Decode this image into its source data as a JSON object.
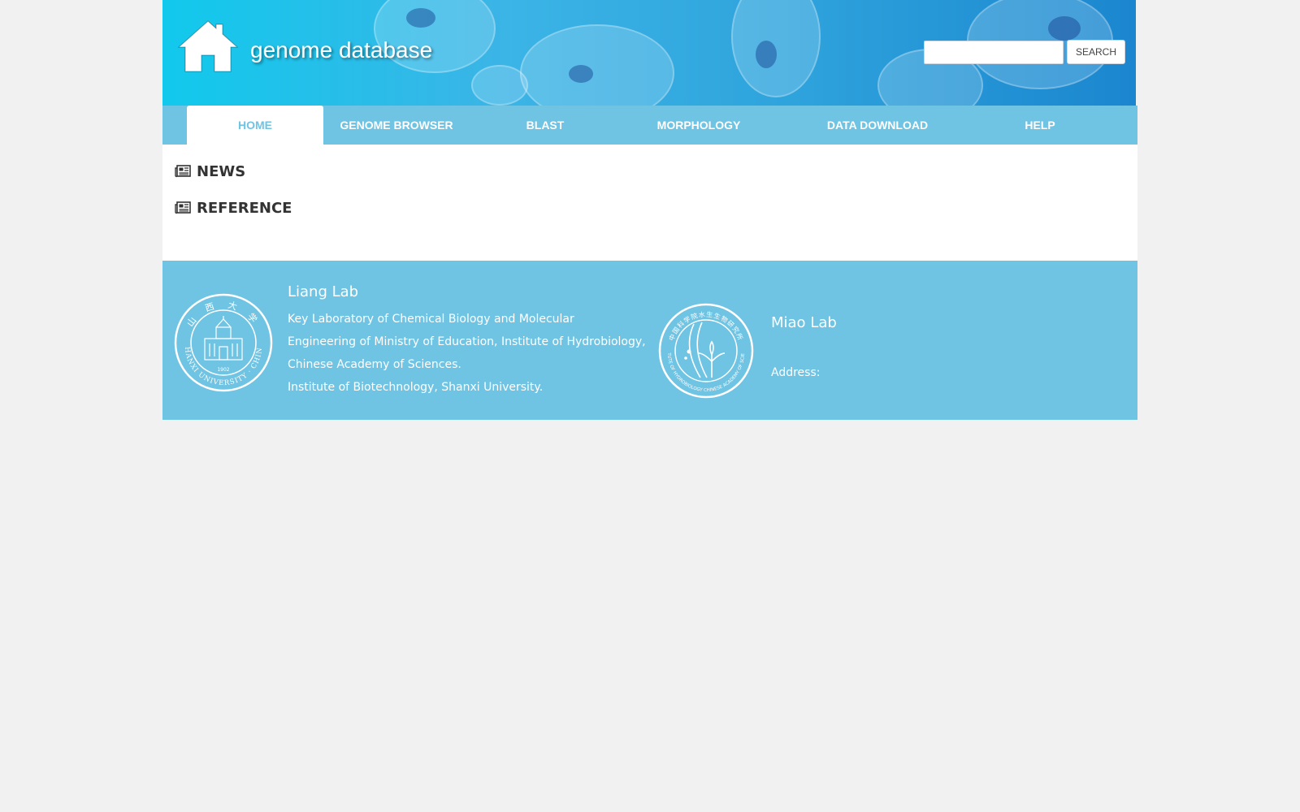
{
  "header": {
    "site_title": "genome database",
    "search": {
      "placeholder": "",
      "button_label": "SEARCH"
    }
  },
  "nav": {
    "items": [
      {
        "label": "HOME",
        "active": true
      },
      {
        "label": "GENOME BROWSER"
      },
      {
        "label": "BLAST"
      },
      {
        "label": "MORPHOLOGY"
      },
      {
        "label": "DATA DOWNLOAD"
      },
      {
        "label": "HELP"
      }
    ]
  },
  "content": {
    "sections": [
      {
        "title": "NEWS",
        "icon": "newspaper-icon"
      },
      {
        "title": "REFERENCE",
        "icon": "newspaper-icon"
      }
    ]
  },
  "footer": {
    "left_lab": {
      "name": "Liang Lab",
      "lines": [
        "Key Laboratory of Chemical Biology and Molecular",
        "Engineering of Ministry of Education, Institute of Hydrobiology,",
        "Chinese Academy of Sciences.",
        "Institute of Biotechnology, Shanxi University."
      ],
      "seal": {
        "top_text": "山 西 大 学",
        "bottom_text": "SHANXI UNIVERSITY · CHINA",
        "year": "1902"
      }
    },
    "right_lab": {
      "name": "Miao Lab",
      "address_label": "Address:",
      "seal": {
        "top_text": "中国科学院水生生物研究所",
        "bottom_text": "INSTITUTE OF HYDROBIOLOGY CHINESE ACADEMY OF SCIENCES"
      }
    }
  },
  "colors": {
    "nav_bg": "#6fc3e3",
    "banner_start": "#11c9ec",
    "banner_end": "#1b86cf",
    "page_bg": "#f1f1f1"
  }
}
